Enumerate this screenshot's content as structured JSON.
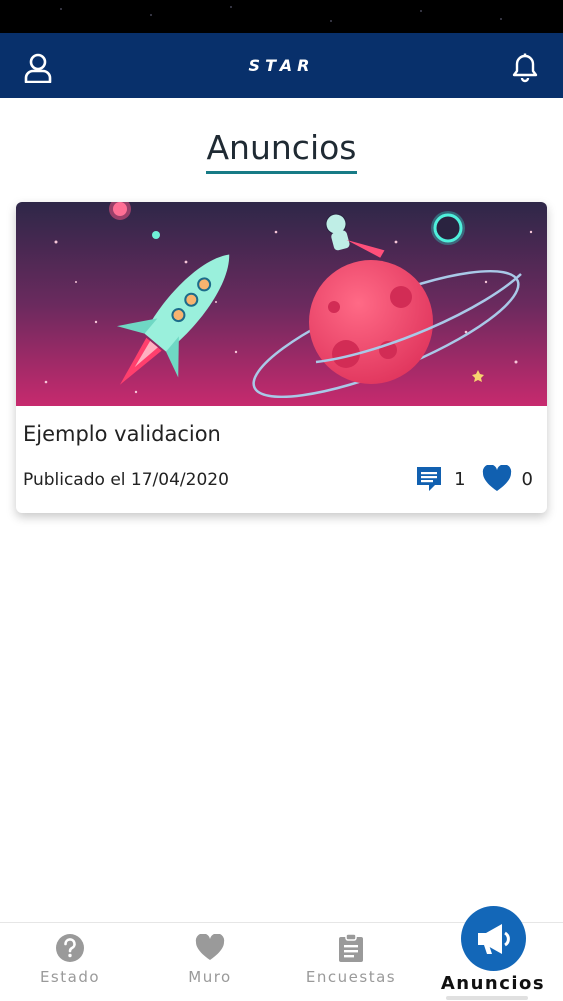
{
  "colors": {
    "appbar": "#08306b",
    "accent_underline": "#177b86",
    "icon_blue": "#1160b0",
    "fab": "#1367b8",
    "nav_inactive": "#9a9a9a"
  },
  "header": {
    "logo_text": "STAR",
    "left_icon": "user-icon",
    "right_icon": "bell-icon"
  },
  "page": {
    "title": "Anuncios"
  },
  "announcements": [
    {
      "title": "Ejemplo validacion",
      "date_text": "Publicado el 17/04/2020",
      "comments": "1",
      "likes": "0",
      "image": "space-rocket-illustration"
    }
  ],
  "bottom_nav": {
    "items": [
      {
        "label": "Estado",
        "icon": "question-icon"
      },
      {
        "label": "Muro",
        "icon": "heart-icon"
      },
      {
        "label": "Encuestas",
        "icon": "clipboard-icon"
      },
      {
        "label": "Anuncios",
        "icon": "megaphone-icon",
        "active": true
      }
    ]
  }
}
